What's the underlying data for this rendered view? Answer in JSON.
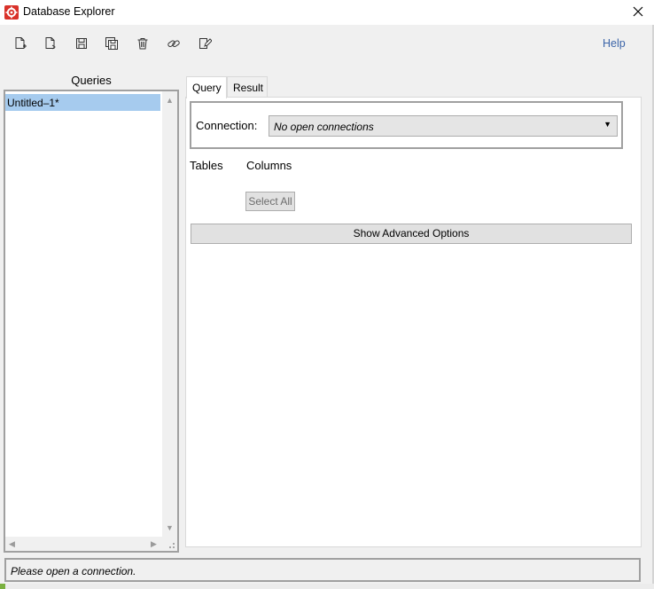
{
  "window": {
    "title": "Database Explorer",
    "icon": "gear-app-icon",
    "close_icon": "close-icon"
  },
  "toolbar": {
    "items": [
      {
        "name": "new-query-button",
        "icon": "new-document-icon"
      },
      {
        "name": "open-query-button",
        "icon": "open-document-icon"
      },
      {
        "name": "save-button",
        "icon": "save-icon"
      },
      {
        "name": "save-all-button",
        "icon": "save-all-icon"
      },
      {
        "name": "delete-button",
        "icon": "trash-icon"
      },
      {
        "name": "connect-button",
        "icon": "link-icon"
      },
      {
        "name": "edit-button",
        "icon": "edit-icon"
      }
    ],
    "help_label": "Help"
  },
  "sidebar": {
    "title": "Queries",
    "items": [
      {
        "label": "Untitled–1*",
        "selected": true
      }
    ]
  },
  "tabs": [
    {
      "label": "Query",
      "active": true
    },
    {
      "label": "Result",
      "active": false
    }
  ],
  "query": {
    "connection_label": "Connection:",
    "connection_value": "No open connections",
    "tables_label": "Tables",
    "columns_label": "Columns",
    "select_all_label": "Select All",
    "advanced_label": "Show Advanced Options"
  },
  "status": {
    "text": "Please open a connection."
  },
  "colors": {
    "selection": "#a6cbee",
    "help_link": "#3b64a8",
    "app_icon": "#d9322a"
  }
}
